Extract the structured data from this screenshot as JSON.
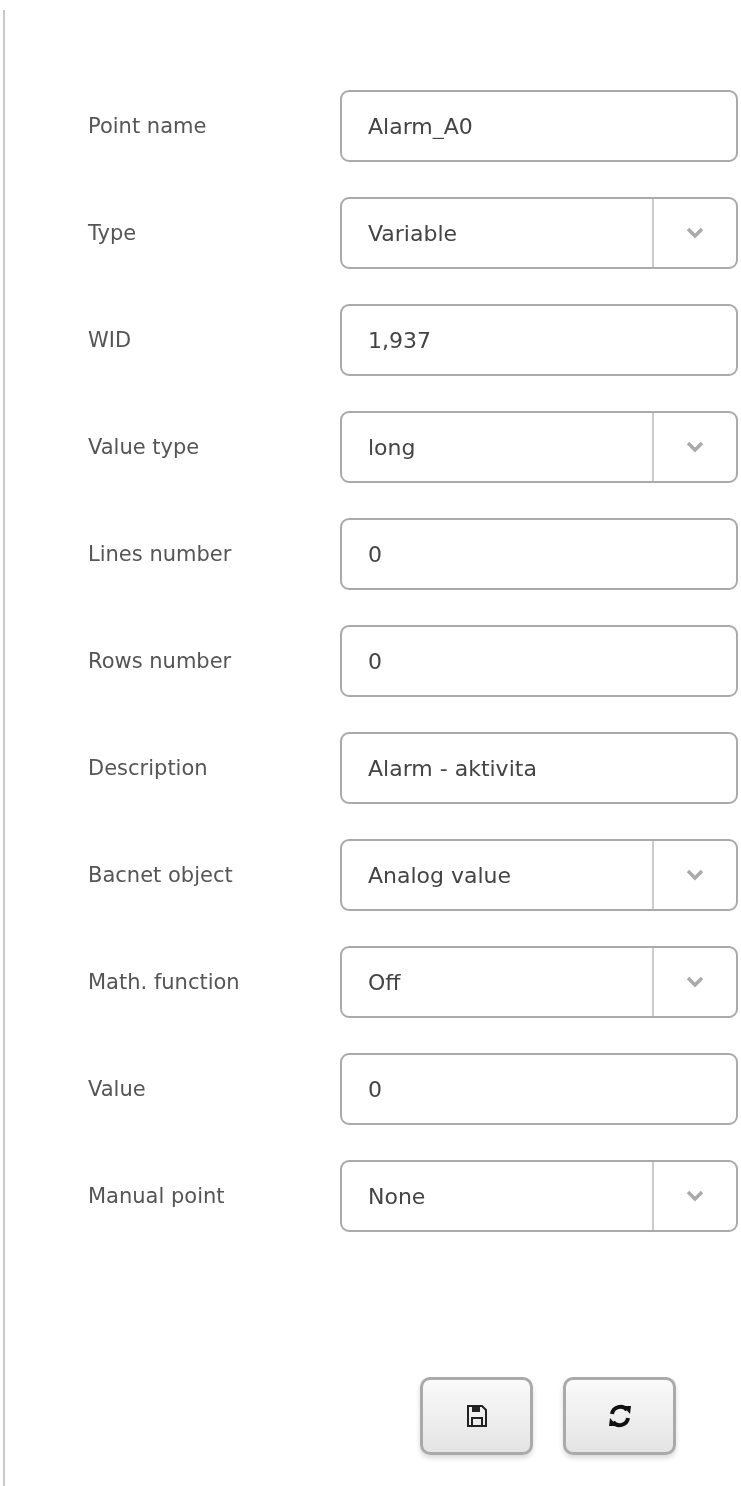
{
  "fields": [
    {
      "label": "Point name",
      "kind": "text",
      "value": "Alarm_A0"
    },
    {
      "label": "Type",
      "kind": "select",
      "value": "Variable"
    },
    {
      "label": "WID",
      "kind": "text",
      "value": "1,937"
    },
    {
      "label": "Value type",
      "kind": "select",
      "value": "long"
    },
    {
      "label": "Lines number",
      "kind": "text",
      "value": "0"
    },
    {
      "label": "Rows number",
      "kind": "text",
      "value": "0"
    },
    {
      "label": "Description",
      "kind": "text",
      "value": "Alarm - aktivita"
    },
    {
      "label": "Bacnet object",
      "kind": "select",
      "value": "Analog value"
    },
    {
      "label": "Math. function",
      "kind": "select",
      "value": "Off"
    },
    {
      "label": "Value",
      "kind": "text",
      "value": "0"
    },
    {
      "label": "Manual point",
      "kind": "select",
      "value": "None"
    }
  ]
}
